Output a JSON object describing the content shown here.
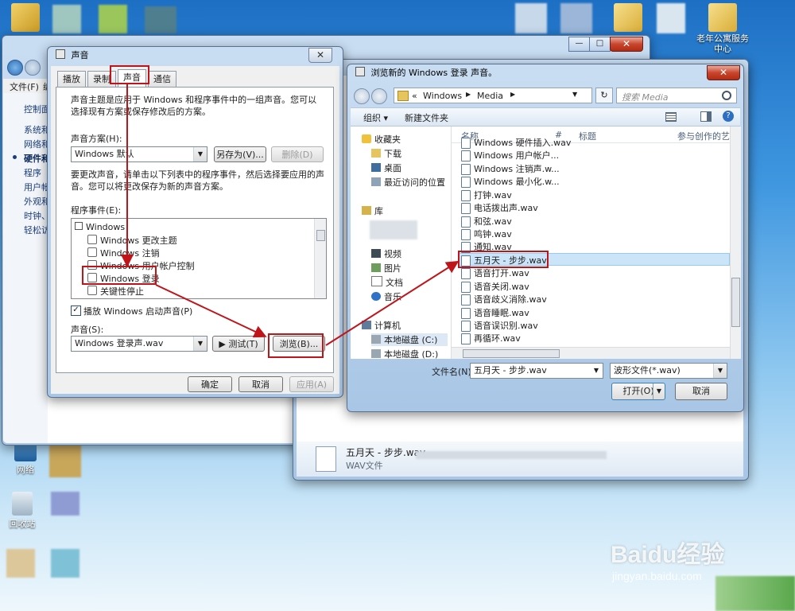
{
  "desktop": {
    "icons": [
      {
        "label": "老年公寓服务中心"
      },
      {
        "label": "网络"
      },
      {
        "label": "回收站"
      }
    ]
  },
  "control_panel": {
    "menu_file": "文件(F)",
    "menu_edit_fragment": "编",
    "items": [
      "控制面",
      "系统和",
      "网络和",
      "硬件和",
      "程序",
      "用户帐",
      "外观和",
      "时钟、",
      "轻松访"
    ],
    "preview_filename": "五月天 - 步步.wav",
    "preview_filetype": "WAV文件"
  },
  "sound_dialog": {
    "title": "声音",
    "tabs": [
      "播放",
      "录制",
      "声音",
      "通信"
    ],
    "description": "声音主题是应用于 Windows 和程序事件中的一组声音。您可以选择现有方案或保存修改后的方案。",
    "scheme_label": "声音方案(H):",
    "scheme_value": "Windows 默认",
    "save_as": "另存为(V)...",
    "delete": "删除(D)",
    "change_desc": "要更改声音，请单击以下列表中的程序事件，然后选择要应用的声音。您可以将更改保存为新的声音方案。",
    "events_label": "程序事件(E):",
    "events": [
      "Windows",
      "Windows 更改主题",
      "Windows 注销",
      "Windows 用户帐户控制",
      "Windows 登录",
      "关键性停止"
    ],
    "startup_checkbox": "播放 Windows 启动声音(P)",
    "sound_label": "声音(S):",
    "sound_value": "Windows 登录声.wav",
    "test": "▶ 测试(T)",
    "browse": "浏览(B)...",
    "ok": "确定",
    "cancel": "取消",
    "apply": "应用(A)"
  },
  "browse_dialog": {
    "title": "浏览新的 Windows 登录 声音。",
    "path_prefix": "«",
    "path": [
      "Windows",
      "Media"
    ],
    "search_placeholder": "搜索 Media",
    "organize": "组织 ▾",
    "new_folder": "新建文件夹",
    "nav": {
      "favorites": "收藏夹",
      "downloads": "下载",
      "desktop": "桌面",
      "recent": "最近访问的位置",
      "libraries": "库",
      "videos": "视频",
      "pictures": "图片",
      "documents": "文档",
      "music": "音乐",
      "computer": "计算机",
      "disk_c": "本地磁盘 (C:)",
      "disk_d": "本地磁盘 (D:)"
    },
    "columns": [
      "名称",
      "#",
      "标题",
      "参与创作的艺术"
    ],
    "files": [
      "Windows 硬件插入.wav",
      "Windows 用户帐户...",
      "Windows 注销声.w...",
      "Windows 最小化.w...",
      "打钟.wav",
      "电话拨出声.wav",
      "和弦.wav",
      "鸣钟.wav",
      "通知.wav",
      "五月天 - 步步.wav",
      "语音打开.wav",
      "语音关闭.wav",
      "语音歧义消除.wav",
      "语音睡眠.wav",
      "语音误识别.wav",
      "再循环.wav"
    ],
    "filename_label": "文件名(N):",
    "filename_value": "五月天 - 步步.wav",
    "filetype_value": "波形文件(*.wav)",
    "open": "打开(O)",
    "cancel": "取消"
  },
  "watermark": {
    "brand": "Baidu经验",
    "url": "jingyan.baidu.com"
  }
}
